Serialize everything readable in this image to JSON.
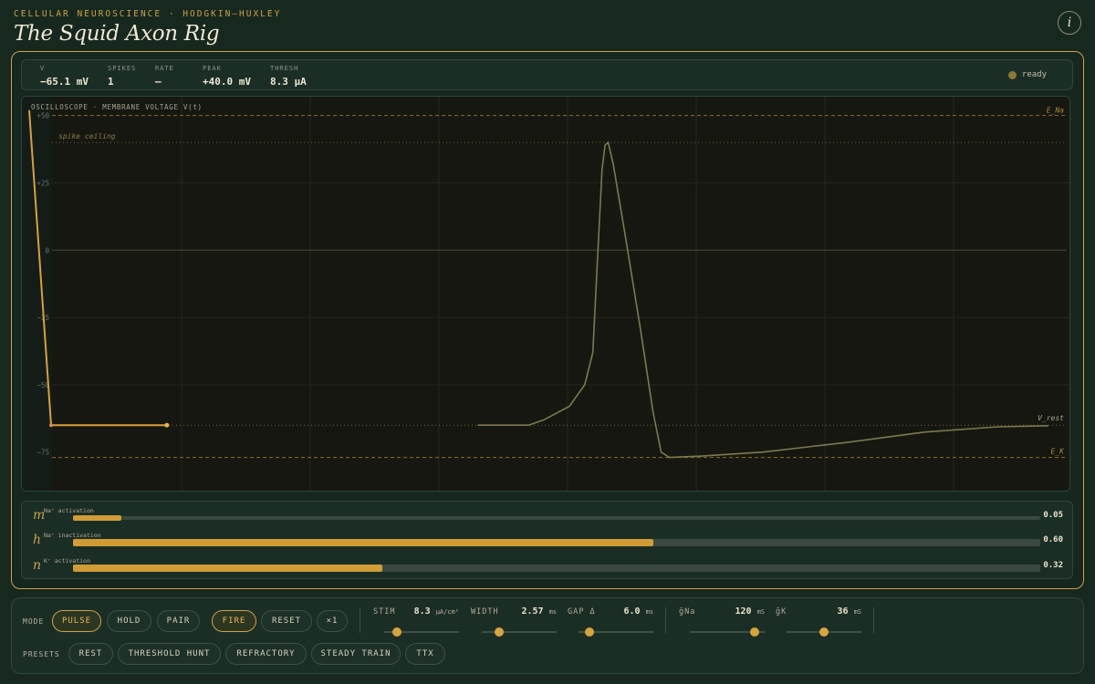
{
  "header": {
    "eyebrow": "CELLULAR NEUROSCIENCE · HODGKIN–HUXLEY",
    "title": "The Squid Axon Rig",
    "info_icon": "i"
  },
  "readout": [
    {
      "label": "V",
      "value": "−65.1 mV"
    },
    {
      "label": "SPIKES",
      "value": "1"
    },
    {
      "label": "RATE",
      "value": "—"
    },
    {
      "label": "PEAK",
      "value": "+40.0 mV"
    },
    {
      "label": "THRESH",
      "value": "8.3 µA"
    }
  ],
  "status": {
    "text": "ready",
    "color": "#8a7836"
  },
  "scope": {
    "title": "OSCILLOSCOPE · MEMBRANE VOLTAGE V(t)",
    "y_ticks": [
      "+50",
      "+25",
      "0",
      "−25",
      "−50",
      "−75"
    ],
    "ref_labels": {
      "ena": "E_Na",
      "ceiling": "spike ceiling",
      "vrest": "V_rest",
      "ek": "E_K"
    },
    "colors": {
      "live_trace": "#d9a03c",
      "ghost_trace": "#7c7a4f",
      "guide": "#8a6b2c"
    }
  },
  "chart_data": {
    "type": "line",
    "title": "OSCILLOSCOPE · MEMBRANE VOLTAGE V(t)",
    "xlabel": "",
    "ylabel": "",
    "ylim": [
      -90,
      57
    ],
    "reference_lines": [
      {
        "name": "E_Na",
        "y": 50
      },
      {
        "name": "spike ceiling",
        "y": 40
      },
      {
        "name": "0",
        "y": 0
      },
      {
        "name": "V_rest",
        "y": -65
      },
      {
        "name": "E_K",
        "y": -77
      }
    ],
    "series": [
      {
        "values": [
          [
            0,
            52
          ],
          [
            0.0215,
            -65
          ],
          [
            0.135,
            -65
          ]
        ]
      },
      {
        "values": [
          [
            0.44,
            -65
          ],
          [
            0.49,
            -65
          ],
          [
            0.505,
            -63
          ],
          [
            0.53,
            -58
          ],
          [
            0.545,
            -50
          ],
          [
            0.553,
            -38
          ],
          [
            0.558,
            0
          ],
          [
            0.562,
            30
          ],
          [
            0.565,
            39
          ],
          [
            0.568,
            40
          ],
          [
            0.573,
            32
          ],
          [
            0.585,
            5
          ],
          [
            0.6,
            -30
          ],
          [
            0.612,
            -60
          ],
          [
            0.62,
            -75
          ],
          [
            0.628,
            -77
          ],
          [
            0.66,
            -76.5
          ],
          [
            0.72,
            -75
          ],
          [
            0.8,
            -71.5
          ],
          [
            0.88,
            -67.5
          ],
          [
            0.95,
            -65.6
          ],
          [
            1.0,
            -65.2
          ]
        ]
      }
    ]
  },
  "gates": [
    {
      "symbol": "m",
      "label": "Na⁺ activation",
      "value": "0.05",
      "fill": 0.05
    },
    {
      "symbol": "h",
      "label": "Na⁺ inactivation",
      "value": "0.60",
      "fill": 0.6
    },
    {
      "symbol": "n",
      "label": "K⁺ activation",
      "value": "0.32",
      "fill": 0.32
    }
  ],
  "controls": {
    "mode_label": "MODE",
    "modes": [
      "PULSE",
      "HOLD",
      "PAIR"
    ],
    "actions": [
      "FIRE",
      "RESET",
      "×1"
    ],
    "presets_label": "PRESETS",
    "presets": [
      "REST",
      "THRESHOLD HUNT",
      "REFRACTORY",
      "STEADY TRAIN",
      "TTX"
    ],
    "sliders": [
      {
        "name": "STIM",
        "value": "8.3",
        "unit": "µA/cm²",
        "level": 0.17
      },
      {
        "name": "WIDTH",
        "value": "2.57",
        "unit": "ms",
        "level": 0.23
      },
      {
        "name": "GAP Δ",
        "value": "6.0",
        "unit": "ms",
        "level": 0.15
      },
      {
        "name": "ḡNa",
        "value": "120",
        "unit": "mS",
        "level": 0.86
      },
      {
        "name": "ḡK",
        "value": "36",
        "unit": "mS",
        "level": 0.5
      }
    ]
  }
}
